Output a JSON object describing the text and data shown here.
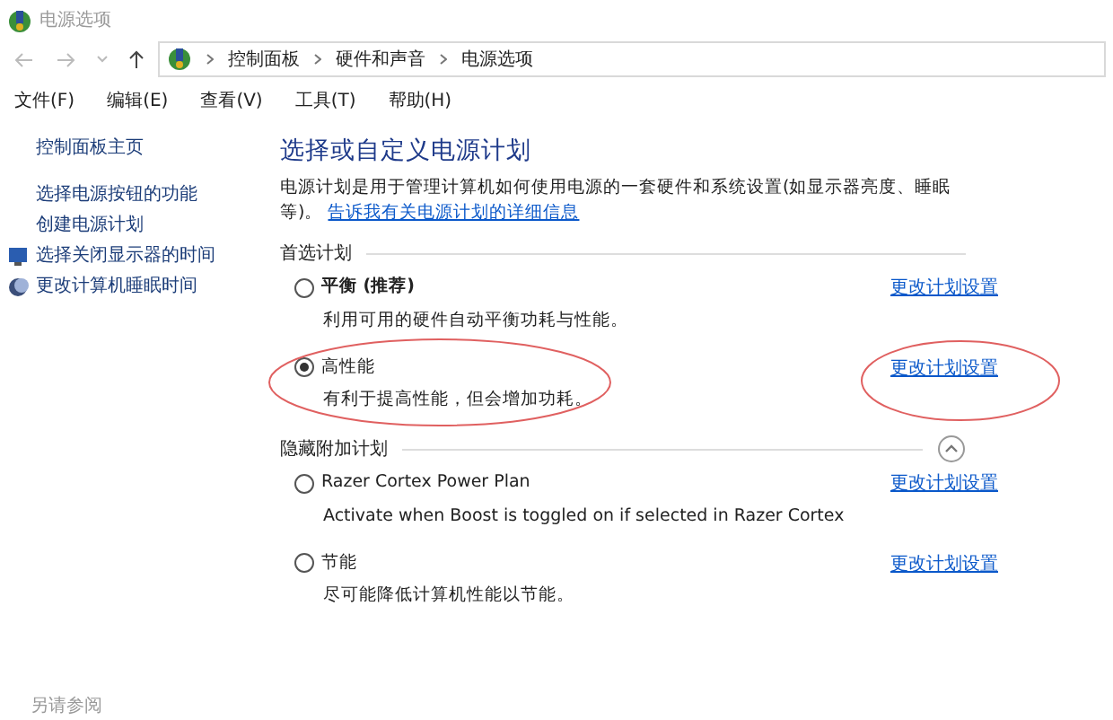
{
  "window": {
    "title": "电源选项"
  },
  "breadcrumb": [
    "控制面板",
    "硬件和声音",
    "电源选项"
  ],
  "menu": [
    "文件(F)",
    "编辑(E)",
    "查看(V)",
    "工具(T)",
    "帮助(H)"
  ],
  "sidebar": {
    "items": [
      {
        "label": "控制面板主页",
        "kind": "home"
      },
      {
        "label": "选择电源按钮的功能",
        "kind": "plain"
      },
      {
        "label": "创建电源计划",
        "kind": "plain"
      },
      {
        "label": "选择关闭显示器的时间",
        "kind": "display"
      },
      {
        "label": "更改计算机睡眠时间",
        "kind": "sleep"
      }
    ],
    "see_also": "另请参阅"
  },
  "heading": "选择或自定义电源计划",
  "intro": "电源计划是用于管理计算机如何使用电源的一套硬件和系统设置(如显示器亮度、睡眠等)。",
  "intro_link": "告诉我有关电源计划的详细信息",
  "sections": [
    {
      "title": "首选计划",
      "collapsible": false,
      "expanded": true,
      "plans": [
        {
          "name": "平衡 (推荐)",
          "bold": true,
          "description": "利用可用的硬件自动平衡功耗与性能。",
          "link": "更改计划设置",
          "selected": false,
          "circled": false
        },
        {
          "name": "高性能",
          "bold": false,
          "description": "有利于提高性能，但会增加功耗。",
          "link": "更改计划设置",
          "selected": true,
          "circled": true
        }
      ]
    },
    {
      "title": "隐藏附加计划",
      "collapsible": true,
      "expanded": true,
      "plans": [
        {
          "name": "Razer Cortex Power Plan",
          "bold": false,
          "description": "Activate when Boost is toggled on if selected in Razer Cortex",
          "link": "更改计划设置",
          "selected": false,
          "circled": false
        },
        {
          "name": "节能",
          "bold": false,
          "description": "尽可能降低计算机性能以节能。",
          "link": "更改计划设置",
          "selected": false,
          "circled": false
        }
      ]
    }
  ]
}
